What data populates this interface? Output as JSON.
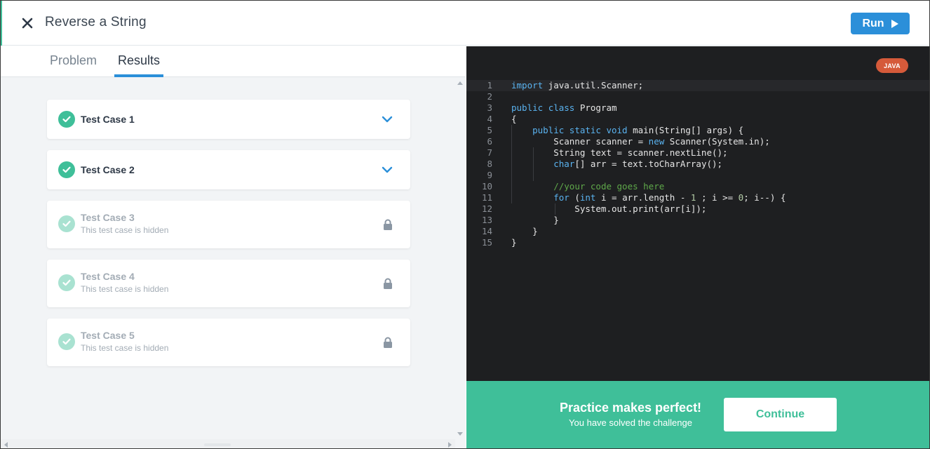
{
  "header": {
    "title": "Reverse a String",
    "run_label": "Run",
    "close_icon": "close-icon",
    "run_icon": "play-icon"
  },
  "tabs": [
    {
      "label": "Problem",
      "active": false
    },
    {
      "label": "Results",
      "active": true
    }
  ],
  "test_cases": [
    {
      "label": "Test Case 1",
      "status": "passed",
      "hidden": false,
      "icon": "chevron-down-icon"
    },
    {
      "label": "Test Case 2",
      "status": "passed",
      "hidden": false,
      "icon": "chevron-down-icon"
    },
    {
      "label": "Test Case 3",
      "status": "passed",
      "hidden": true,
      "sub": "This test case is hidden",
      "icon": "lock-icon"
    },
    {
      "label": "Test Case 4",
      "status": "passed",
      "hidden": true,
      "sub": "This test case is hidden",
      "icon": "lock-icon"
    },
    {
      "label": "Test Case 5",
      "status": "passed",
      "hidden": true,
      "sub": "This test case is hidden",
      "icon": "lock-icon"
    }
  ],
  "editor": {
    "language": "JAVA",
    "lines": [
      "import java.util.Scanner;",
      "",
      "public class Program",
      "{",
      "    public static void main(String[] args) {",
      "        Scanner scanner = new Scanner(System.in);",
      "        String text = scanner.nextLine();",
      "        char[] arr = text.toCharArray();",
      "",
      "        //your code goes here",
      "        for (int i = arr.length - 1 ; i >= 0; i--) {",
      "            System.out.print(arr[i]);",
      "        }",
      "    }",
      "}"
    ]
  },
  "banner": {
    "headline": "Practice makes perfect!",
    "subtext": "You have solved the challenge",
    "continue_label": "Continue"
  },
  "colors": {
    "accent_green": "#3fbf99",
    "primary_blue": "#2b8fd9",
    "java_badge": "#d55a3a",
    "editor_bg": "#1e1f21"
  }
}
